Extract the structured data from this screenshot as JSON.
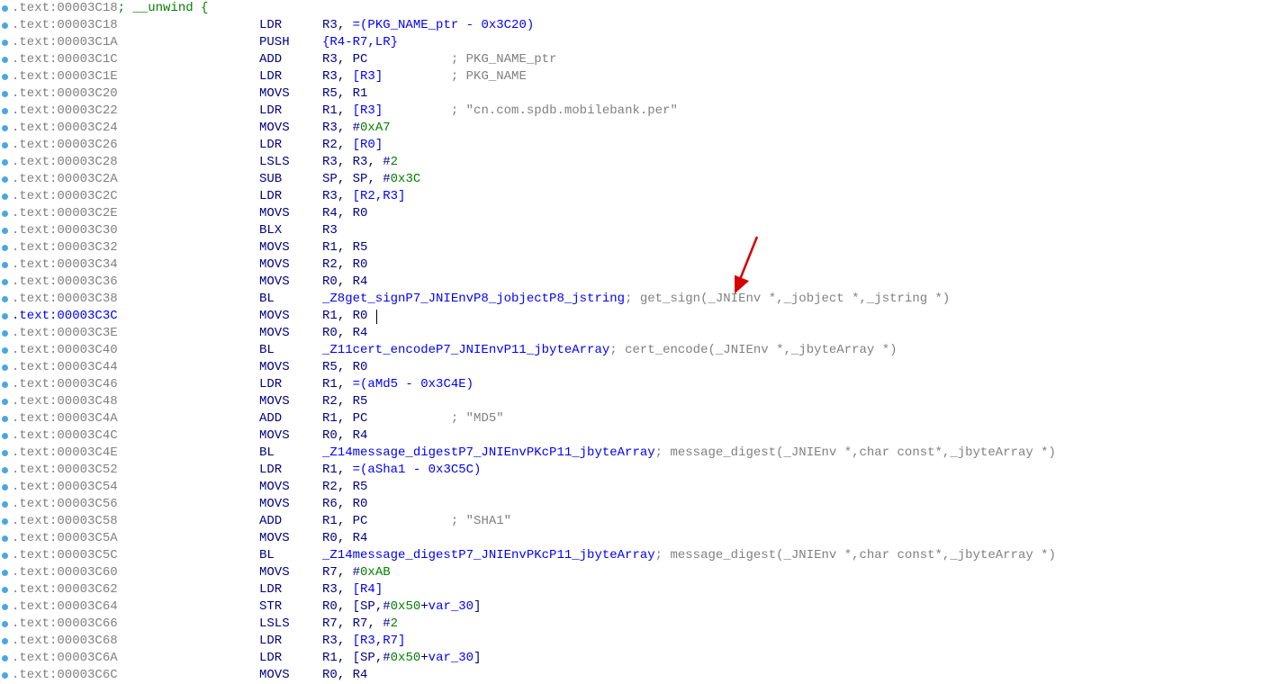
{
  "lines": [
    {
      "addr": ".text:00003C18",
      "directive": "; __unwind {",
      "is_directive_line": true
    },
    {
      "addr": ".text:00003C18",
      "mnem": "LDR",
      "ops": [
        [
          "reg",
          "R3"
        ],
        [
          "plain",
          ", "
        ],
        [
          "sym",
          "=(PKG_NAME_ptr - 0x3C20)"
        ]
      ]
    },
    {
      "addr": ".text:00003C1A",
      "mnem": "PUSH",
      "ops": [
        [
          "sym",
          "{R4-R7,LR}"
        ]
      ]
    },
    {
      "addr": ".text:00003C1C",
      "mnem": "ADD",
      "ops": [
        [
          "reg",
          "R3"
        ],
        [
          "plain",
          ", "
        ],
        [
          "reg",
          "PC"
        ]
      ],
      "cmt": "; PKG_NAME_ptr"
    },
    {
      "addr": ".text:00003C1E",
      "mnem": "LDR",
      "ops": [
        [
          "reg",
          "R3"
        ],
        [
          "plain",
          ", "
        ],
        [
          "sym",
          "[R3]"
        ]
      ],
      "cmt": "; PKG_NAME"
    },
    {
      "addr": ".text:00003C20",
      "mnem": "MOVS",
      "ops": [
        [
          "reg",
          "R5"
        ],
        [
          "plain",
          ", "
        ],
        [
          "reg",
          "R1"
        ]
      ]
    },
    {
      "addr": ".text:00003C22",
      "mnem": "LDR",
      "ops": [
        [
          "reg",
          "R1"
        ],
        [
          "plain",
          ", "
        ],
        [
          "sym",
          "[R3]"
        ]
      ],
      "cmt": "; \"cn.com.spdb.mobilebank.per\""
    },
    {
      "addr": ".text:00003C24",
      "mnem": "MOVS",
      "ops": [
        [
          "reg",
          "R3"
        ],
        [
          "plain",
          ", #"
        ],
        [
          "num",
          "0xA7"
        ]
      ]
    },
    {
      "addr": ".text:00003C26",
      "mnem": "LDR",
      "ops": [
        [
          "reg",
          "R2"
        ],
        [
          "plain",
          ", "
        ],
        [
          "sym",
          "[R0]"
        ]
      ]
    },
    {
      "addr": ".text:00003C28",
      "mnem": "LSLS",
      "ops": [
        [
          "reg",
          "R3"
        ],
        [
          "plain",
          ", "
        ],
        [
          "reg",
          "R3"
        ],
        [
          "plain",
          ", #"
        ],
        [
          "num",
          "2"
        ]
      ]
    },
    {
      "addr": ".text:00003C2A",
      "mnem": "SUB",
      "ops": [
        [
          "reg",
          "SP"
        ],
        [
          "plain",
          ", "
        ],
        [
          "reg",
          "SP"
        ],
        [
          "plain",
          ", #"
        ],
        [
          "num",
          "0x3C"
        ]
      ]
    },
    {
      "addr": ".text:00003C2C",
      "mnem": "LDR",
      "ops": [
        [
          "reg",
          "R3"
        ],
        [
          "plain",
          ", "
        ],
        [
          "sym",
          "[R2,R3]"
        ]
      ]
    },
    {
      "addr": ".text:00003C2E",
      "mnem": "MOVS",
      "ops": [
        [
          "reg",
          "R4"
        ],
        [
          "plain",
          ", "
        ],
        [
          "reg",
          "R0"
        ]
      ]
    },
    {
      "addr": ".text:00003C30",
      "mnem": "BLX",
      "ops": [
        [
          "reg",
          "R3"
        ]
      ]
    },
    {
      "addr": ".text:00003C32",
      "mnem": "MOVS",
      "ops": [
        [
          "reg",
          "R1"
        ],
        [
          "plain",
          ", "
        ],
        [
          "reg",
          "R5"
        ]
      ]
    },
    {
      "addr": ".text:00003C34",
      "mnem": "MOVS",
      "ops": [
        [
          "reg",
          "R2"
        ],
        [
          "plain",
          ", "
        ],
        [
          "reg",
          "R0"
        ]
      ]
    },
    {
      "addr": ".text:00003C36",
      "mnem": "MOVS",
      "ops": [
        [
          "reg",
          "R0"
        ],
        [
          "plain",
          ", "
        ],
        [
          "reg",
          "R4"
        ]
      ]
    },
    {
      "addr": ".text:00003C38",
      "mnem": "BL",
      "ops": [
        [
          "sym",
          "_Z8get_signP7_JNIEnvP8_jobjectP8_jstring"
        ]
      ],
      "cmt": "; get_sign(_JNIEnv *,_jobject *,_jstring *)",
      "cmt_tight": true
    },
    {
      "addr": ".text:00003C3C",
      "addr_hl": true,
      "mnem": "MOVS",
      "ops": [
        [
          "reg",
          "R1"
        ],
        [
          "plain",
          ", "
        ],
        [
          "reg",
          "R0"
        ]
      ],
      "cursor": true
    },
    {
      "addr": ".text:00003C3E",
      "mnem": "MOVS",
      "ops": [
        [
          "reg",
          "R0"
        ],
        [
          "plain",
          ", "
        ],
        [
          "reg",
          "R4"
        ]
      ]
    },
    {
      "addr": ".text:00003C40",
      "mnem": "BL",
      "ops": [
        [
          "sym",
          "_Z11cert_encodeP7_JNIEnvP11_jbyteArray"
        ]
      ],
      "cmt": "; cert_encode(_JNIEnv *,_jbyteArray *)",
      "cmt_tight": true
    },
    {
      "addr": ".text:00003C44",
      "mnem": "MOVS",
      "ops": [
        [
          "reg",
          "R5"
        ],
        [
          "plain",
          ", "
        ],
        [
          "reg",
          "R0"
        ]
      ]
    },
    {
      "addr": ".text:00003C46",
      "mnem": "LDR",
      "ops": [
        [
          "reg",
          "R1"
        ],
        [
          "plain",
          ", "
        ],
        [
          "sym",
          "=(aMd5 - 0x3C4E)"
        ]
      ]
    },
    {
      "addr": ".text:00003C48",
      "mnem": "MOVS",
      "ops": [
        [
          "reg",
          "R2"
        ],
        [
          "plain",
          ", "
        ],
        [
          "reg",
          "R5"
        ]
      ]
    },
    {
      "addr": ".text:00003C4A",
      "mnem": "ADD",
      "ops": [
        [
          "reg",
          "R1"
        ],
        [
          "plain",
          ", "
        ],
        [
          "reg",
          "PC"
        ]
      ],
      "cmt": "; \"MD5\""
    },
    {
      "addr": ".text:00003C4C",
      "mnem": "MOVS",
      "ops": [
        [
          "reg",
          "R0"
        ],
        [
          "plain",
          ", "
        ],
        [
          "reg",
          "R4"
        ]
      ]
    },
    {
      "addr": ".text:00003C4E",
      "mnem": "BL",
      "ops": [
        [
          "sym",
          "_Z14message_digestP7_JNIEnvPKcP11_jbyteArray"
        ]
      ],
      "cmt": "; message_digest(_JNIEnv *,char const*,_jbyteArray *)",
      "cmt_tight": true
    },
    {
      "addr": ".text:00003C52",
      "mnem": "LDR",
      "ops": [
        [
          "reg",
          "R1"
        ],
        [
          "plain",
          ", "
        ],
        [
          "sym",
          "=(aSha1 - 0x3C5C)"
        ]
      ]
    },
    {
      "addr": ".text:00003C54",
      "mnem": "MOVS",
      "ops": [
        [
          "reg",
          "R2"
        ],
        [
          "plain",
          ", "
        ],
        [
          "reg",
          "R5"
        ]
      ]
    },
    {
      "addr": ".text:00003C56",
      "mnem": "MOVS",
      "ops": [
        [
          "reg",
          "R6"
        ],
        [
          "plain",
          ", "
        ],
        [
          "reg",
          "R0"
        ]
      ]
    },
    {
      "addr": ".text:00003C58",
      "mnem": "ADD",
      "ops": [
        [
          "reg",
          "R1"
        ],
        [
          "plain",
          ", "
        ],
        [
          "reg",
          "PC"
        ]
      ],
      "cmt": "; \"SHA1\""
    },
    {
      "addr": ".text:00003C5A",
      "mnem": "MOVS",
      "ops": [
        [
          "reg",
          "R0"
        ],
        [
          "plain",
          ", "
        ],
        [
          "reg",
          "R4"
        ]
      ]
    },
    {
      "addr": ".text:00003C5C",
      "mnem": "BL",
      "ops": [
        [
          "sym",
          "_Z14message_digestP7_JNIEnvPKcP11_jbyteArray"
        ]
      ],
      "cmt": "; message_digest(_JNIEnv *,char const*,_jbyteArray *)",
      "cmt_tight": true
    },
    {
      "addr": ".text:00003C60",
      "mnem": "MOVS",
      "ops": [
        [
          "reg",
          "R7"
        ],
        [
          "plain",
          ", #"
        ],
        [
          "num",
          "0xAB"
        ]
      ]
    },
    {
      "addr": ".text:00003C62",
      "mnem": "LDR",
      "ops": [
        [
          "reg",
          "R3"
        ],
        [
          "plain",
          ", "
        ],
        [
          "sym",
          "[R4]"
        ]
      ]
    },
    {
      "addr": ".text:00003C64",
      "mnem": "STR",
      "ops": [
        [
          "reg",
          "R0"
        ],
        [
          "plain",
          ", ["
        ],
        [
          "reg",
          "SP"
        ],
        [
          "plain",
          ",#"
        ],
        [
          "num",
          "0x50"
        ],
        [
          "plain",
          "+"
        ],
        [
          "sym",
          "var_30"
        ],
        [
          "plain",
          "]"
        ]
      ]
    },
    {
      "addr": ".text:00003C66",
      "mnem": "LSLS",
      "ops": [
        [
          "reg",
          "R7"
        ],
        [
          "plain",
          ", "
        ],
        [
          "reg",
          "R7"
        ],
        [
          "plain",
          ", #"
        ],
        [
          "num",
          "2"
        ]
      ]
    },
    {
      "addr": ".text:00003C68",
      "mnem": "LDR",
      "ops": [
        [
          "reg",
          "R3"
        ],
        [
          "plain",
          ", "
        ],
        [
          "sym",
          "[R3,R7]"
        ]
      ]
    },
    {
      "addr": ".text:00003C6A",
      "mnem": "LDR",
      "ops": [
        [
          "reg",
          "R1"
        ],
        [
          "plain",
          ", ["
        ],
        [
          "reg",
          "SP"
        ],
        [
          "plain",
          ",#"
        ],
        [
          "num",
          "0x50"
        ],
        [
          "plain",
          "+"
        ],
        [
          "sym",
          "var_30"
        ],
        [
          "plain",
          "]"
        ]
      ]
    },
    {
      "addr": ".text:00003C6C",
      "mnem": "MOVS",
      "ops": [
        [
          "reg",
          "R0"
        ],
        [
          "plain",
          ", "
        ],
        [
          "reg",
          "R4"
        ]
      ]
    }
  ]
}
